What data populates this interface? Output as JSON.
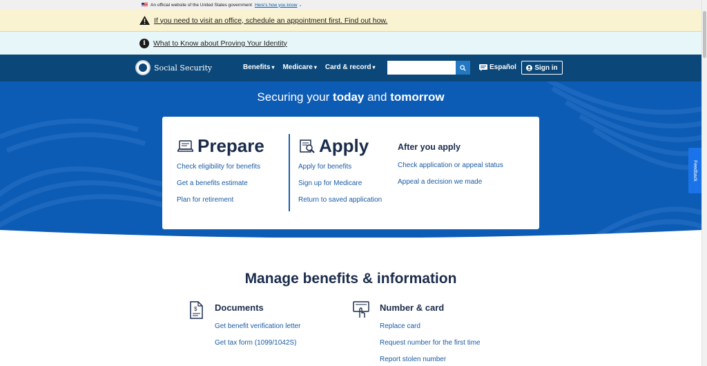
{
  "gov_banner": {
    "text": "An official website of the United States government",
    "link": "Here's how you know"
  },
  "alerts": {
    "warning": "If you need to visit an office, schedule an appointment first. Find out how.",
    "info": "What to Know about Proving Your Identity"
  },
  "nav": {
    "logo": "Social Security",
    "menu": [
      "Benefits",
      "Medicare",
      "Card & record"
    ],
    "search_placeholder": "",
    "espanol": "Español",
    "signin": "Sign in"
  },
  "hero": {
    "title_pre": "Securing your ",
    "title_b1": "today",
    "title_mid": " and ",
    "title_b2": "tomorrow"
  },
  "card": {
    "prepare": {
      "title": "Prepare",
      "links": [
        "Check eligibility for benefits",
        "Get a benefits estimate",
        "Plan for retirement"
      ]
    },
    "apply": {
      "title": "Apply",
      "links": [
        "Apply for benefits",
        "Sign up for Medicare",
        "Return to saved application"
      ]
    },
    "after": {
      "title": "After you apply",
      "links": [
        "Check application or appeal status",
        "Appeal a decision we made"
      ]
    }
  },
  "feedback": "Feedback",
  "manage": {
    "title": "Manage benefits & information",
    "documents": {
      "title": "Documents",
      "links": [
        "Get benefit verification letter",
        "Get tax form (1099/1042S)"
      ]
    },
    "number_card": {
      "title": "Number & card",
      "links": [
        "Replace card",
        "Request number for the first time",
        "Report stolen number"
      ]
    }
  },
  "colors": {
    "nav": "#0b4778",
    "hero": "#0c5cb6",
    "link": "#1a5aa5",
    "heading": "#1a2b4b",
    "warning_bg": "#faf3d1",
    "info_bg": "#e7f6f8"
  }
}
